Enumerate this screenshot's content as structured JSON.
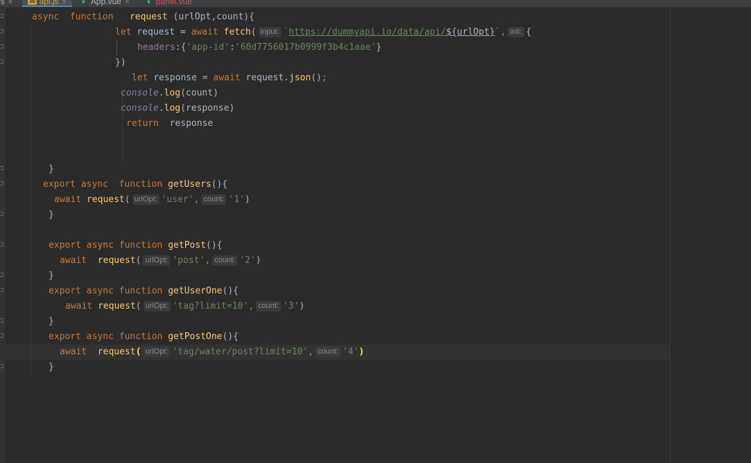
{
  "tabs": [
    {
      "label": "api.js",
      "active": true
    },
    {
      "label": "App.vue",
      "active": false
    },
    {
      "label": "panel.vue",
      "active": false
    }
  ],
  "code": {
    "l1_async": "async",
    "l1_function": "function",
    "l1_name": "request",
    "l1_params": "(urlOpt,count){",
    "l2_let": "let",
    "l2_var": "request",
    "l2_eq": "=",
    "l2_await": "await",
    "l2_fetch": "fetch",
    "l2_paren": "(",
    "l2_hint": "input:",
    "l2_tick_open": "`",
    "l2_url": "https://dummyapi.io/data/api/",
    "l2_tpl": "${urlOpt}",
    "l2_tick_close": "`",
    "l2_comma": ",",
    "l2_hint2": "init:",
    "l2_brace": "{",
    "l3_headers": "headers",
    "l3_colon": ":{",
    "l3_key": "'app-id'",
    "l3_colon2": ":",
    "l3_val": "'60d7756017b0999f3b4c1aae'",
    "l3_close": "}",
    "l4_close": "})",
    "l5_let": "let",
    "l5_rest": "response = ",
    "l5_await": "await",
    "l5_req": "request.",
    "l5_json": "json",
    "l5_paren": "()",
    "l5_semi": ";",
    "l6_console": "console",
    "l6_dot": ".",
    "l6_log": "log",
    "l6_args": "(count)",
    "l7_console": "console",
    "l7_dot": ".",
    "l7_log": "log",
    "l7_args": "(response)",
    "l8_return": "return",
    "l8_value": "response",
    "l9_close": "}",
    "getUsers": {
      "export": "export",
      "async": "async",
      "function": "function",
      "name": "getUsers",
      "open": "(){",
      "await": "await",
      "call": "request",
      "paren": "(",
      "hint1": "urlOpt:",
      "arg1": "'user'",
      "comma": ",",
      "hint2": "count:",
      "arg2": "'1'",
      "close_paren": ")",
      "close": "}"
    },
    "getPost": {
      "export": "export",
      "async": "async",
      "function": "function",
      "name": "getPost",
      "open": "(){",
      "await": "await",
      "call": "request",
      "paren": "(",
      "hint1": "urlOpt:",
      "arg1": "'post'",
      "comma": ",",
      "hint2": "count:",
      "arg2": "'2'",
      "close_paren": ")",
      "close": "}"
    },
    "getUserOne": {
      "export": "export",
      "async": "async",
      "function": "function",
      "name": "getUserOne",
      "open": "(){",
      "await": "await",
      "call": "request",
      "paren": "(",
      "hint1": "urlOpt:",
      "arg1": "'tag?limit=10'",
      "comma": ",",
      "hint2": "count:",
      "arg2": "'3'",
      "close_paren": ")",
      "close": "}"
    },
    "getPostOne": {
      "export": "export",
      "async": "async",
      "function": "function",
      "name": "getPostOne",
      "open": "(){",
      "await": "await",
      "call": "request",
      "paren": "(",
      "hint1": "urlOpt:",
      "arg1": "'tag/water/post?limit=10'",
      "comma": ",",
      "hint2": "count:",
      "arg2": "'4'",
      "close_paren": ")",
      "close": "}"
    }
  },
  "colors": {
    "background": "#2b2b2b",
    "keyword": "#cc7832",
    "function": "#ffc66d",
    "string": "#6a8759",
    "object": "#9876aa",
    "text": "#a9b7c6"
  }
}
